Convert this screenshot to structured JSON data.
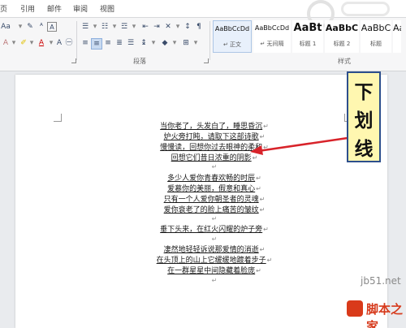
{
  "tabs": [
    "页",
    "引用",
    "邮件",
    "审阅",
    "视图"
  ],
  "ribbon": {
    "paragraph_label": "段落",
    "styles_label": "样式"
  },
  "styles_gallery": [
    {
      "sample": "AaBbCcDd",
      "name": "↵ 正文",
      "selected": true
    },
    {
      "sample": "AaBbCcDd",
      "name": "↵ 无间隔",
      "selected": false
    },
    {
      "sample": "AaBt",
      "name": "标题 1",
      "selected": false
    },
    {
      "sample": "AaBbC",
      "name": "标题 2",
      "selected": false
    },
    {
      "sample": "AaBbC",
      "name": "标题",
      "selected": false
    },
    {
      "sample": "AaBb",
      "name": "",
      "selected": false
    }
  ],
  "poem": {
    "stanza1": [
      "当你老了，头发白了，睡思昏沉",
      "炉火旁打盹，请取下这部诗歌",
      "慢慢读，回想你过去眼神的柔和",
      "回想它们昔日浓重的阴影"
    ],
    "stanza2": [
      "多少人爱你青春欢畅的时辰",
      "爱慕你的美丽，假意和真心",
      "只有一个人爱你朝圣者的灵魂",
      "爱你衰老了的脸上痛苦的皱纹"
    ],
    "stanza3": [
      "垂下头来，在红火闪耀的炉子旁"
    ],
    "stanza4": [
      "凄然地轻轻诉说那爱情的消逝",
      "在头顶上的山上它缓缓地踱着步子",
      "在一群星星中间隐藏着脸庞"
    ],
    "para_mark": "↵"
  },
  "annotation": {
    "chars": [
      "下",
      "划",
      "线"
    ],
    "color": "#d8232a"
  },
  "watermark": {
    "url": "jb51.net",
    "name": "脚本之家"
  }
}
